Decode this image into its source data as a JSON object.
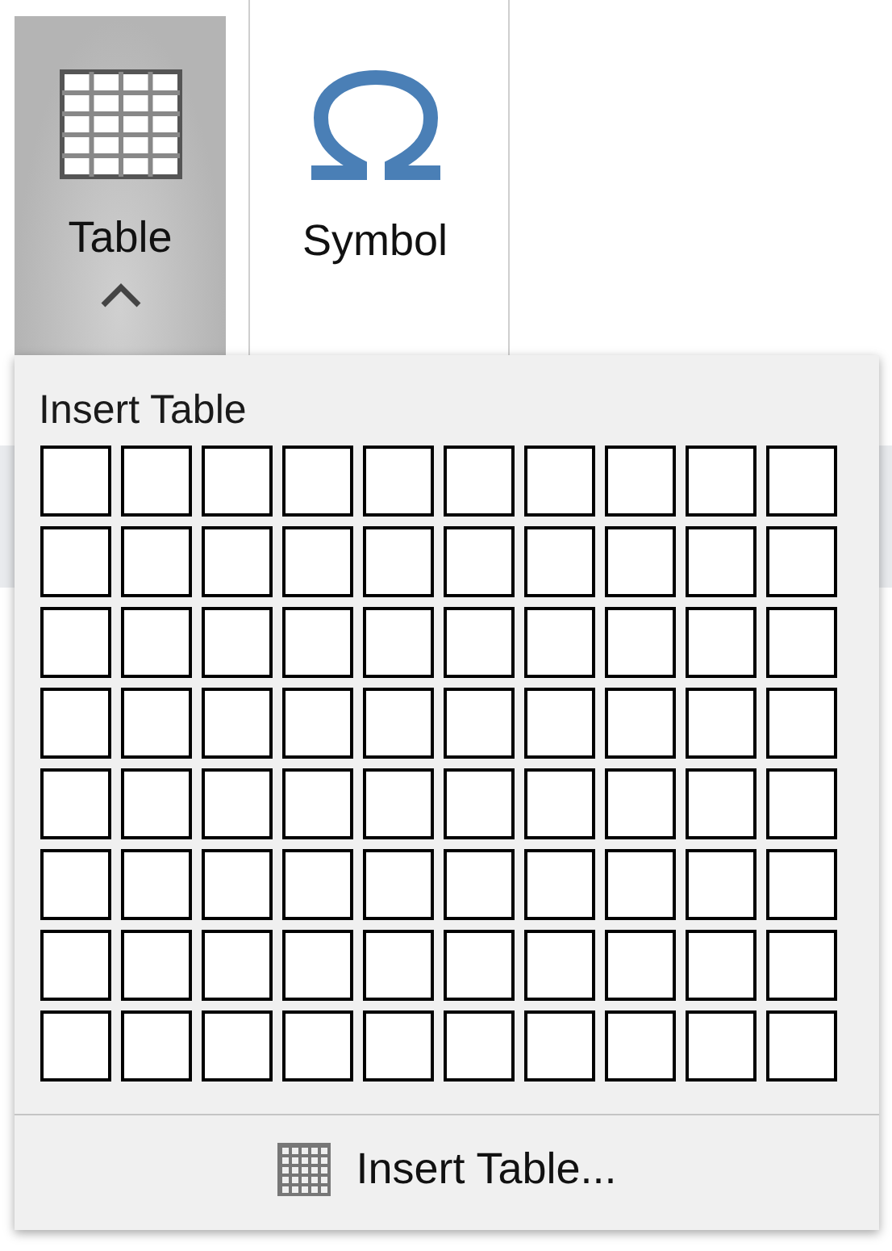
{
  "ribbon": {
    "buttons": [
      {
        "label": "Table",
        "kind": "table",
        "selected": true,
        "expanded": true
      },
      {
        "label": "Symbol",
        "kind": "symbol",
        "selected": false
      }
    ]
  },
  "popup": {
    "title": "Insert Table",
    "grid": [
      {
        "cells": [
          {
            "selected": false
          },
          {
            "selected": false
          },
          {
            "selected": false
          },
          {
            "selected": false
          },
          {
            "selected": false
          },
          {
            "selected": false
          },
          {
            "selected": false
          },
          {
            "selected": false
          },
          {
            "selected": false
          },
          {
            "selected": false
          }
        ]
      },
      {
        "cells": [
          {
            "selected": false
          },
          {
            "selected": false
          },
          {
            "selected": false
          },
          {
            "selected": false
          },
          {
            "selected": false
          },
          {
            "selected": false
          },
          {
            "selected": false
          },
          {
            "selected": false
          },
          {
            "selected": false
          },
          {
            "selected": false
          }
        ]
      },
      {
        "cells": [
          {
            "selected": false
          },
          {
            "selected": false
          },
          {
            "selected": false
          },
          {
            "selected": false
          },
          {
            "selected": false
          },
          {
            "selected": false
          },
          {
            "selected": false
          },
          {
            "selected": false
          },
          {
            "selected": false
          },
          {
            "selected": false
          }
        ]
      },
      {
        "cells": [
          {
            "selected": false
          },
          {
            "selected": false
          },
          {
            "selected": false
          },
          {
            "selected": false
          },
          {
            "selected": false
          },
          {
            "selected": false
          },
          {
            "selected": false
          },
          {
            "selected": false
          },
          {
            "selected": false
          },
          {
            "selected": false
          }
        ]
      },
      {
        "cells": [
          {
            "selected": false
          },
          {
            "selected": false
          },
          {
            "selected": false
          },
          {
            "selected": false
          },
          {
            "selected": false
          },
          {
            "selected": false
          },
          {
            "selected": false
          },
          {
            "selected": false
          },
          {
            "selected": false
          },
          {
            "selected": false
          }
        ]
      },
      {
        "cells": [
          {
            "selected": false
          },
          {
            "selected": false
          },
          {
            "selected": false
          },
          {
            "selected": false
          },
          {
            "selected": false
          },
          {
            "selected": false
          },
          {
            "selected": false
          },
          {
            "selected": false
          },
          {
            "selected": false
          },
          {
            "selected": false
          }
        ]
      },
      {
        "cells": [
          {
            "selected": false
          },
          {
            "selected": false
          },
          {
            "selected": false
          },
          {
            "selected": false
          },
          {
            "selected": false
          },
          {
            "selected": false
          },
          {
            "selected": false
          },
          {
            "selected": false
          },
          {
            "selected": false
          },
          {
            "selected": false
          }
        ]
      },
      {
        "cells": [
          {
            "selected": false
          },
          {
            "selected": false
          },
          {
            "selected": false
          },
          {
            "selected": false
          },
          {
            "selected": false
          },
          {
            "selected": false
          },
          {
            "selected": false
          },
          {
            "selected": false
          },
          {
            "selected": false
          },
          {
            "selected": false
          }
        ]
      }
    ],
    "footer_button": {
      "label": "Insert Table..."
    }
  }
}
